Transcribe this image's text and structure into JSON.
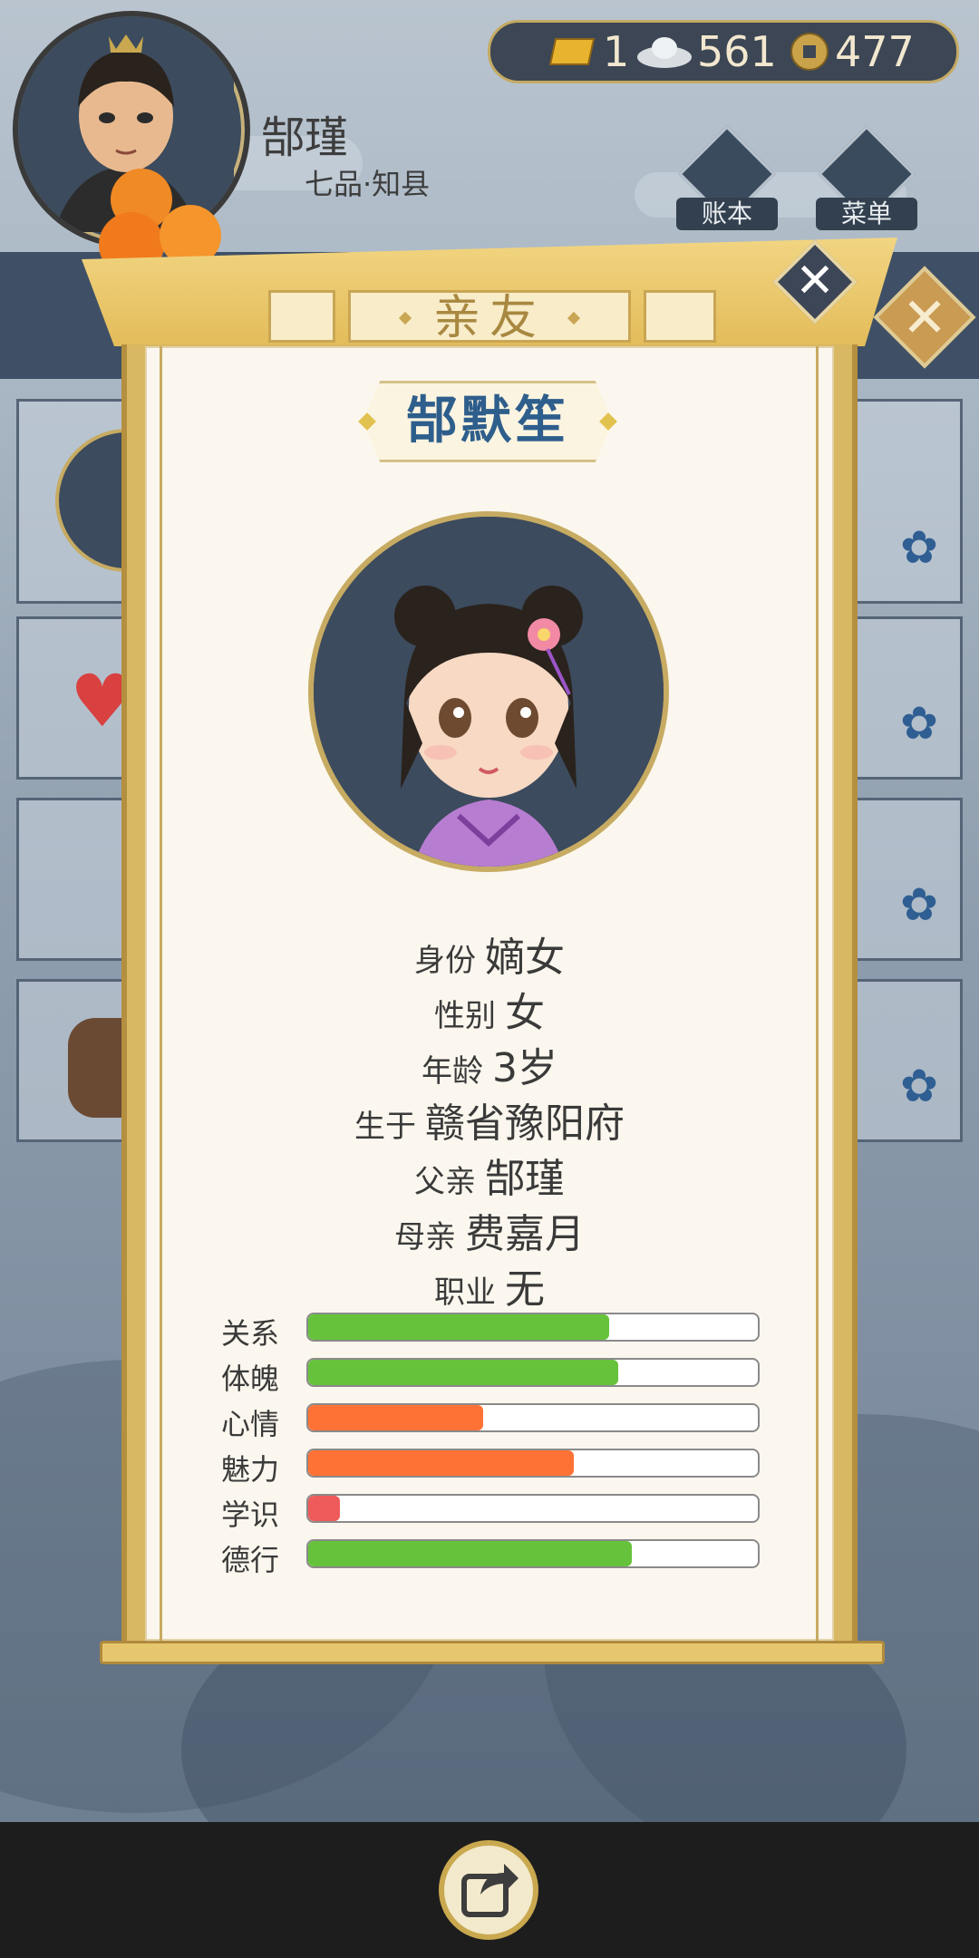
{
  "player": {
    "name": "郜瑾",
    "rank": "七品·知县"
  },
  "currency": {
    "gold": "1",
    "silver": "561",
    "copper": "477"
  },
  "top_buttons": {
    "ledger": "账本",
    "menu": "菜单"
  },
  "dialog": {
    "title": "亲友",
    "character_name": "郜默笙",
    "info": [
      {
        "label": "身份",
        "value": "嫡女"
      },
      {
        "label": "性别",
        "value": "女"
      },
      {
        "label": "年龄",
        "value": "3岁"
      },
      {
        "label": "生于",
        "value": "赣省豫阳府"
      },
      {
        "label": "父亲",
        "value": "郜瑾"
      },
      {
        "label": "母亲",
        "value": "费嘉月"
      },
      {
        "label": "职业",
        "value": "无"
      }
    ],
    "stats": [
      {
        "label": "关系",
        "level": 0.67,
        "color": "#66c23b"
      },
      {
        "label": "体魄",
        "level": 0.69,
        "color": "#66c23b"
      },
      {
        "label": "心情",
        "level": 0.39,
        "color": "#ff7235"
      },
      {
        "label": "魅力",
        "level": 0.59,
        "color": "#ff7235"
      },
      {
        "label": "学识",
        "level": 0.07,
        "color": "#ef5b5b"
      },
      {
        "label": "德行",
        "level": 0.72,
        "color": "#66c23b"
      }
    ]
  }
}
